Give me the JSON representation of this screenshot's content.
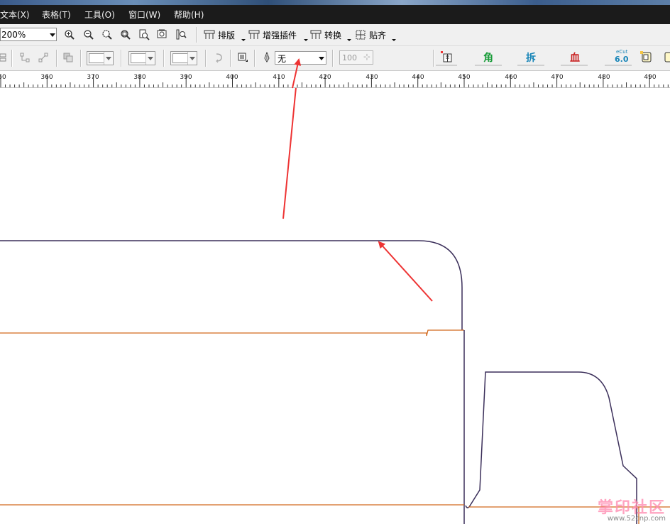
{
  "menus": [
    "文本(X)",
    "表格(T)",
    "工具(O)",
    "窗口(W)",
    "帮助(H)"
  ],
  "toolbar": {
    "zoom_value": "200%",
    "layout_label": "排版",
    "enhance_plugin_label": "增强插件",
    "convert_label": "转换",
    "snap_label": "贴齐"
  },
  "property_bar": {
    "outline_value": "无",
    "number_value": "100"
  },
  "plugins": {
    "corner_label": "角",
    "split_label": "拆",
    "blood_label": "血",
    "ecut_top": "eCut",
    "ecut_version": "6.0"
  },
  "ruler": {
    "labels": [
      "50",
      "360",
      "370",
      "380",
      "390",
      "400",
      "410",
      "420",
      "430",
      "440",
      "450",
      "460",
      "470",
      "480",
      "490"
    ]
  },
  "watermark": {
    "brand": "掌印社区",
    "url": "www.52cnp.com"
  },
  "colors": {
    "menubar": "#1b1b1b",
    "toolbar": "#f0f0f0",
    "outline_purple": "#3b2f5a",
    "line_orange": "#d2691e",
    "arrow_red": "#ee3333",
    "plugin_green": "#1a9c3a",
    "plugin_teal": "#1a86b8",
    "plugin_red": "#c81e1e"
  }
}
